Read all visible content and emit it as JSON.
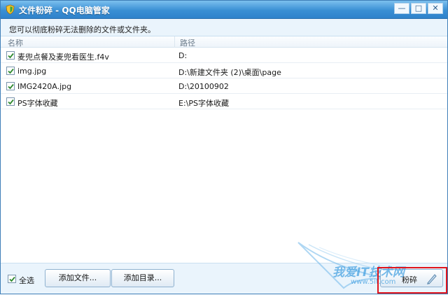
{
  "window": {
    "title": "文件粉碎 - QQ电脑管家",
    "minimize_glyph": "—",
    "maximize_glyph": "□",
    "close_glyph": "✕",
    "accent": "#3a8fd4"
  },
  "description": "您可以彻底粉碎无法删除的文件或文件夹。",
  "table": {
    "columns": [
      "名称",
      "路径"
    ],
    "rows": [
      {
        "checked": true,
        "name": "麦兜点餐及麦兜看医生.f4v",
        "path": "D:"
      },
      {
        "checked": true,
        "name": "img.jpg",
        "path": "D:\\新建文件夹 (2)\\桌面\\page"
      },
      {
        "checked": true,
        "name": "IMG2420A.jpg",
        "path": "D:\\20100902"
      },
      {
        "checked": true,
        "name": "PS字体收藏",
        "path": "E:\\PS字体收藏"
      }
    ]
  },
  "footer": {
    "select_all_label": "全选",
    "select_all_checked": true,
    "add_file_label": "添加文件...",
    "add_dir_label": "添加目录...",
    "shred_label": "粉碎",
    "shred_icon": "shred-icon",
    "highlight_color": "#e0141c"
  },
  "watermark": {
    "text": "我爱IT技术网",
    "sub": "www.5it.com"
  }
}
